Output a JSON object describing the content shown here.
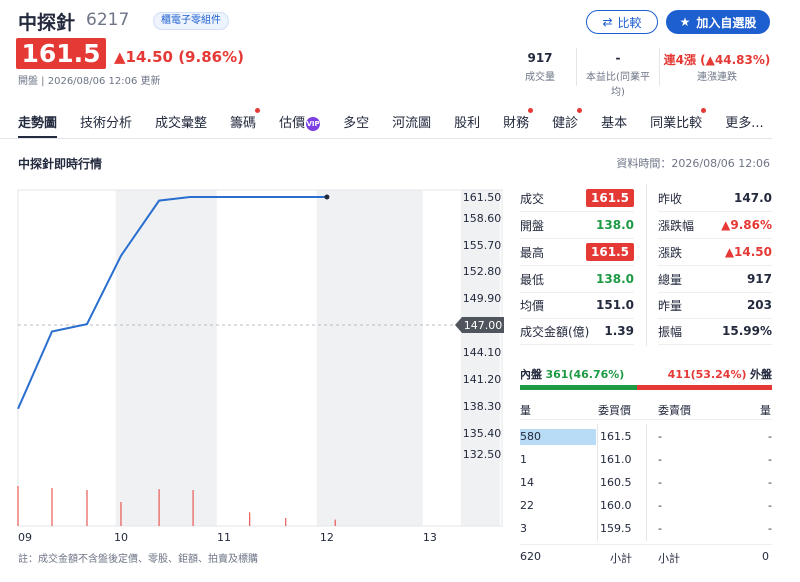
{
  "stock": {
    "name": "中探針",
    "code": "6217",
    "tag": "櫃電子零組件",
    "price": "161.5",
    "change": "▲14.50 (9.86%)",
    "status": "開盤 | 2026/08/06 12:06 更新"
  },
  "buttons": {
    "compare": "比較",
    "watchlist": "加入自選股"
  },
  "header_stats": [
    {
      "value": "917",
      "label": "成交量"
    },
    {
      "value": "-",
      "label": "本益比(同業平均)"
    },
    {
      "value": "連4漲 (▲44.83%)",
      "label": "連漲連跌"
    }
  ],
  "tabs": [
    {
      "label": "走勢圖",
      "dot": false
    },
    {
      "label": "技術分析",
      "dot": false
    },
    {
      "label": "成交彙整",
      "dot": false
    },
    {
      "label": "籌碼",
      "dot": true
    },
    {
      "label": "估價",
      "dot": false,
      "badge": "VIP"
    },
    {
      "label": "多空",
      "dot": false
    },
    {
      "label": "河流圖",
      "dot": false
    },
    {
      "label": "股利",
      "dot": false
    },
    {
      "label": "財務",
      "dot": true
    },
    {
      "label": "健診",
      "dot": true
    },
    {
      "label": "基本",
      "dot": false
    },
    {
      "label": "同業比較",
      "dot": true
    },
    {
      "label": "更多...",
      "dot": false
    }
  ],
  "section": {
    "title": "中探針即時行情",
    "data_time": "資料時間：2026/08/06 12:06"
  },
  "chart_data": {
    "type": "line",
    "x_ticks": [
      "09",
      "10",
      "11",
      "12",
      "13"
    ],
    "y_ticks": [
      "161.50",
      "158.60",
      "155.70",
      "152.80",
      "149.90",
      "147.00",
      "144.10",
      "141.20",
      "138.30",
      "135.40",
      "132.50"
    ],
    "reference_price": "147.00",
    "ylim": [
      132.5,
      161.5
    ],
    "x_hours": [
      9.0,
      9.33,
      9.67,
      10.0,
      10.37,
      10.67,
      11.0,
      11.5,
      12.0
    ],
    "y_prices": [
      138.0,
      146.3,
      147.1,
      154.5,
      161.0,
      161.5,
      161.5,
      161.5,
      161.5
    ],
    "volume_hours": [
      9.0,
      9.33,
      9.67,
      10.0,
      10.37,
      10.7,
      11.25,
      11.6,
      12.08
    ],
    "volume_relative": [
      1.0,
      0.95,
      0.9,
      0.6,
      0.92,
      0.9,
      0.34,
      0.2,
      0.16
    ],
    "grid": true
  },
  "quote": {
    "left": [
      {
        "label": "成交",
        "value": "161.5",
        "style": "redbox"
      },
      {
        "label": "開盤",
        "value": "138.0",
        "style": "green"
      },
      {
        "label": "最高",
        "value": "161.5",
        "style": "redbox"
      },
      {
        "label": "最低",
        "value": "138.0",
        "style": "green"
      },
      {
        "label": "均價",
        "value": "151.0",
        "style": ""
      },
      {
        "label": "成交金額(億)",
        "value": "1.39",
        "style": ""
      }
    ],
    "right": [
      {
        "label": "昨收",
        "value": "147.0",
        "style": ""
      },
      {
        "label": "漲跌幅",
        "value": "▲9.86%",
        "style": "red"
      },
      {
        "label": "漲跌",
        "value": "▲14.50",
        "style": "red"
      },
      {
        "label": "總量",
        "value": "917",
        "style": ""
      },
      {
        "label": "昨量",
        "value": "203",
        "style": ""
      },
      {
        "label": "振幅",
        "value": "15.99%",
        "style": ""
      }
    ]
  },
  "inner_outer": {
    "inner_label": "內盤",
    "inner_value": "361(46.76%)",
    "outer_value": "411(53.24%)",
    "outer_label": "外盤"
  },
  "orderbook": {
    "headers": {
      "bid_qty": "量",
      "bid_price": "委買價",
      "ask_price": "委賣價",
      "ask_qty": "量"
    },
    "rows": [
      {
        "bid_qty": "580",
        "bid_price": "161.5",
        "ask_price": "-",
        "ask_qty": "-"
      },
      {
        "bid_qty": "1",
        "bid_price": "161.0",
        "ask_price": "-",
        "ask_qty": "-"
      },
      {
        "bid_qty": "14",
        "bid_price": "160.5",
        "ask_price": "-",
        "ask_qty": "-"
      },
      {
        "bid_qty": "22",
        "bid_price": "160.0",
        "ask_price": "-",
        "ask_qty": "-"
      },
      {
        "bid_qty": "3",
        "bid_price": "159.5",
        "ask_price": "-",
        "ask_qty": "-"
      }
    ],
    "totals": {
      "bid_total": "620",
      "bid_label": "小計",
      "ask_label": "小計",
      "ask_total": "0"
    }
  },
  "footnote": "註：成交金額不含盤後定價、零股、鉅額、拍賣及標購",
  "colors": {
    "up": "#e53935",
    "down": "#1e9a45",
    "accent": "#1e5fd0",
    "line": "#2a6fd0"
  }
}
